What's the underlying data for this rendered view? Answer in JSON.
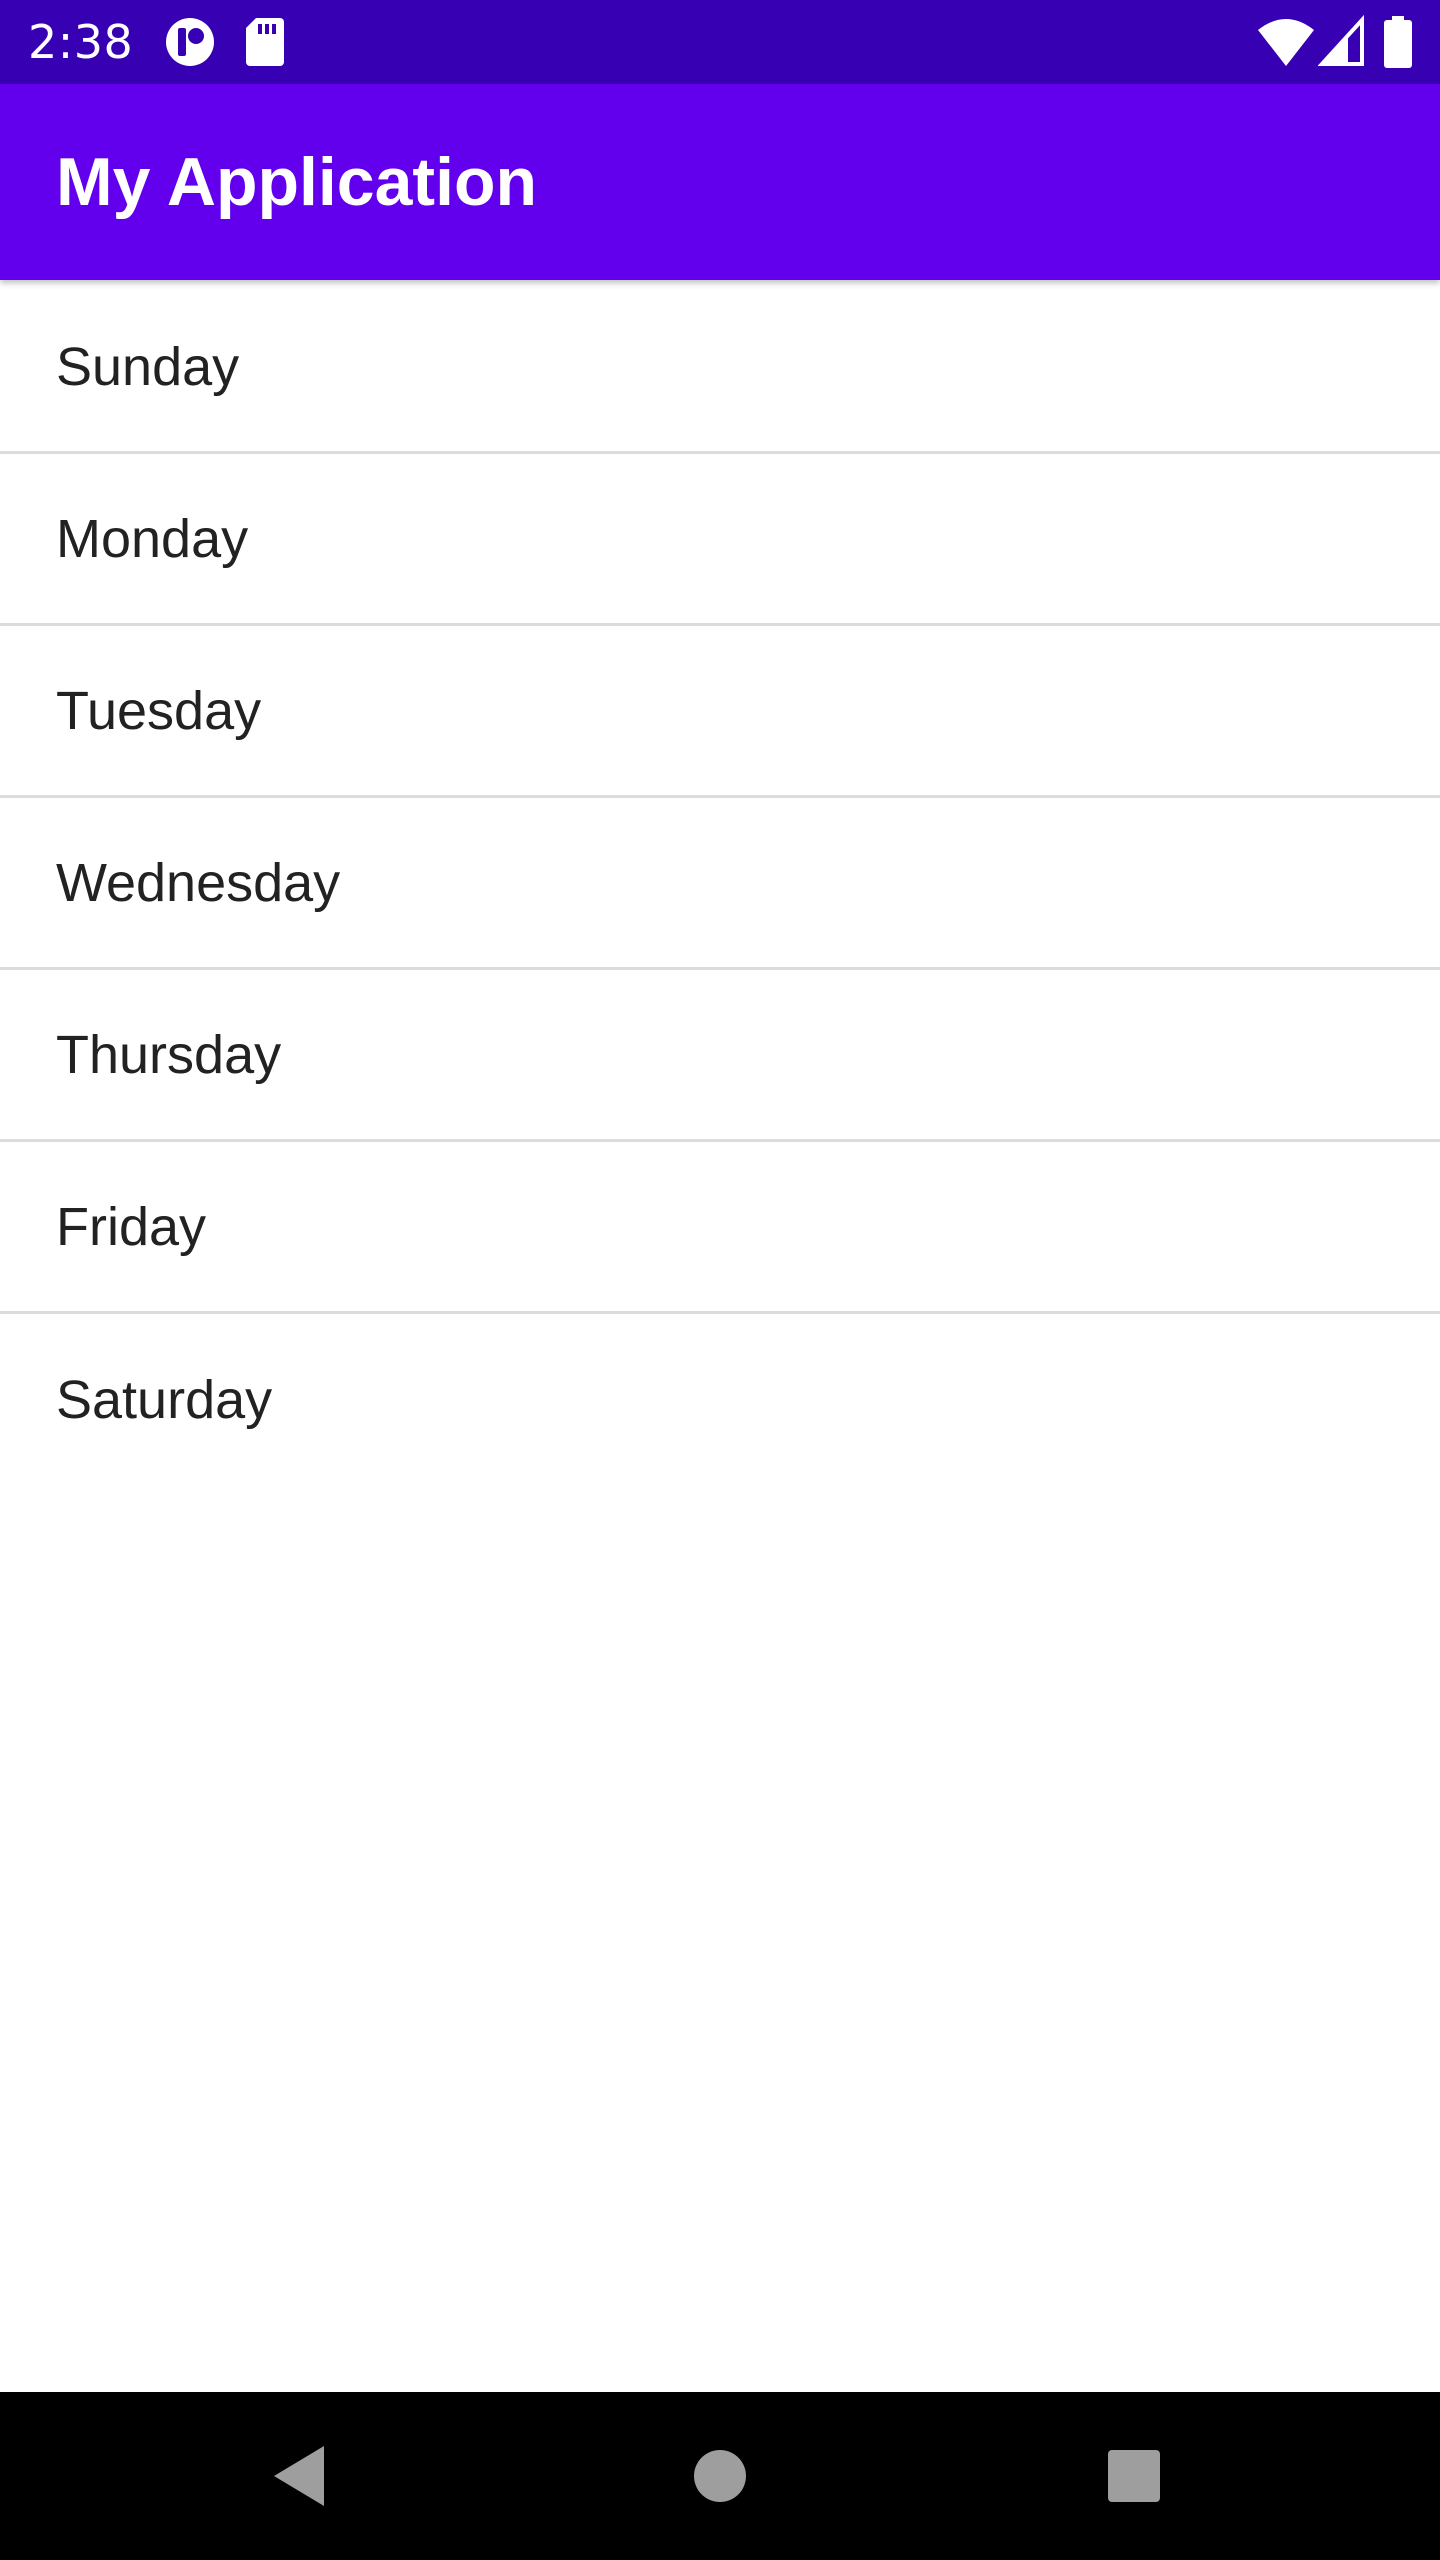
{
  "status_bar": {
    "time": "2:38",
    "background": "#3700b3",
    "icons": [
      "notification-app-icon",
      "sd-card-icon",
      "wifi-icon",
      "cell-signal-icon",
      "battery-icon"
    ]
  },
  "app_bar": {
    "title": "My Application",
    "background": "#6200ee"
  },
  "list": {
    "items": [
      {
        "label": "Sunday"
      },
      {
        "label": "Monday"
      },
      {
        "label": "Tuesday"
      },
      {
        "label": "Wednesday"
      },
      {
        "label": "Thursday"
      },
      {
        "label": "Friday"
      },
      {
        "label": "Saturday"
      }
    ]
  },
  "nav_bar": {
    "buttons": [
      "back-icon",
      "home-icon",
      "recents-icon"
    ]
  }
}
